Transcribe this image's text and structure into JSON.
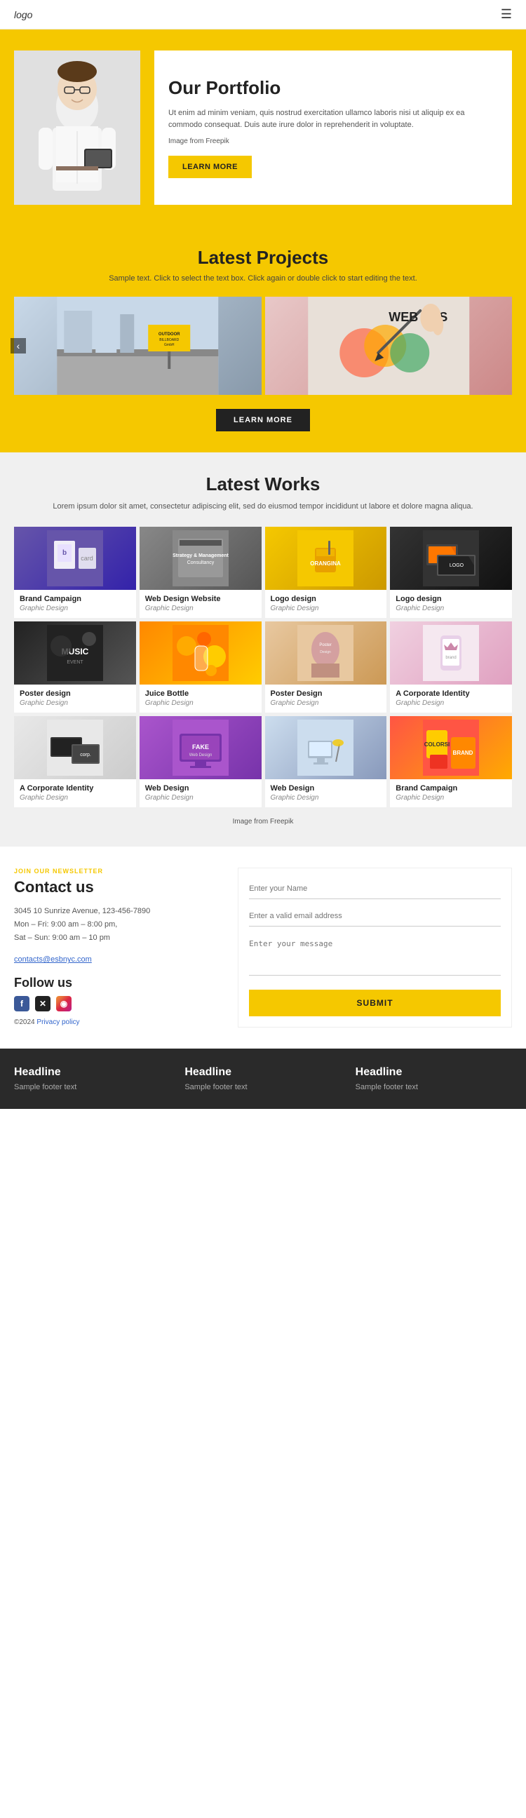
{
  "header": {
    "logo": "logo",
    "menu_icon": "☰"
  },
  "hero": {
    "title": "Our Portfolio",
    "text": "Ut enim ad minim veniam, quis nostrud exercitation ullamco laboris nisi ut aliquip ex ea commodo consequat. Duis aute irure dolor in reprehenderit in voluptate.",
    "freepik_text": "Image from Freepik",
    "button_label": "LEARN MORE"
  },
  "latest_projects": {
    "title": "Latest Projects",
    "subtitle": "Sample text. Click to select the text box. Click again or double click to start editing the text.",
    "button_label": "LEARN MORE",
    "carousel_arrow": "‹"
  },
  "latest_works": {
    "title": "Latest Works",
    "subtitle": "Lorem ipsum dolor sit amet, consectetur adipiscing elit, sed do eiusmod tempor incididunt ut labore et dolore magna aliqua.",
    "freepik_text": "Image from Freepik",
    "items": [
      {
        "name": "Brand Campaign",
        "category": "Graphic Design",
        "thumb": "brand"
      },
      {
        "name": "Web Design Website",
        "category": "Graphic Design",
        "thumb": "webdesign"
      },
      {
        "name": "Logo design",
        "category": "Graphic Design",
        "thumb": "logo"
      },
      {
        "name": "Logo design",
        "category": "Graphic Design",
        "thumb": "logo2"
      },
      {
        "name": "Poster design",
        "category": "Graphic Design",
        "thumb": "poster"
      },
      {
        "name": "Juice Bottle",
        "category": "Graphic Design",
        "thumb": "juice"
      },
      {
        "name": "Poster Design",
        "category": "Graphic Design",
        "thumb": "poster2"
      },
      {
        "name": "A Corporate Identity",
        "category": "Graphic Design",
        "thumb": "corporate"
      },
      {
        "name": "A Corporate Identity",
        "category": "Graphic Design",
        "thumb": "corp2"
      },
      {
        "name": "Web Design",
        "category": "Graphic Design",
        "thumb": "fake"
      },
      {
        "name": "Web Design",
        "category": "Graphic Design",
        "thumb": "webdes2"
      },
      {
        "name": "Brand Campaign",
        "category": "Graphic Design",
        "thumb": "brand2"
      }
    ]
  },
  "contact": {
    "join_label": "JOIN OUR NEWSLETTER",
    "title": "Contact us",
    "address": "3045 10 Sunrize Avenue, 123-456-7890\nMon – Fri: 9:00 am – 8:00 pm,\nSat – Sun: 9:00 am – 10 pm",
    "email": "contacts@esbnyc.com",
    "follow_title": "Follow us",
    "copyright": "©2024 Privacy policy",
    "form": {
      "name_placeholder": "Enter your Name",
      "email_placeholder": "Enter a valid email address",
      "message_placeholder": "Enter your message",
      "submit_label": "SUBMIT"
    }
  },
  "footer": {
    "columns": [
      {
        "headline": "Headline",
        "text": "Sample footer text"
      },
      {
        "headline": "Headline",
        "text": "Sample footer text"
      },
      {
        "headline": "Headline",
        "text": "Sample footer text"
      }
    ]
  }
}
